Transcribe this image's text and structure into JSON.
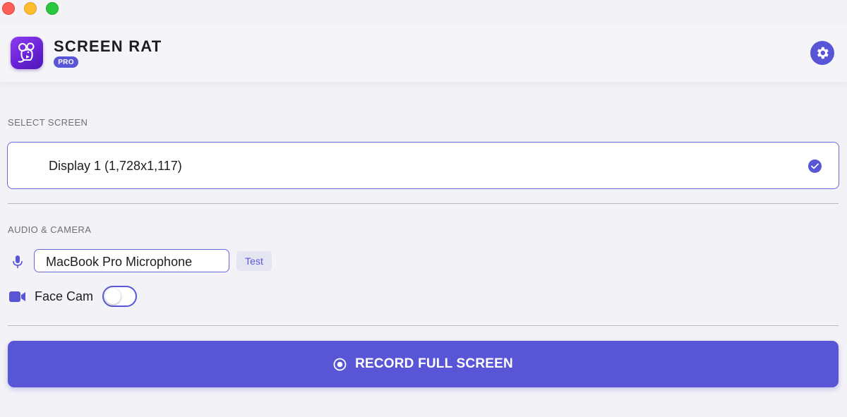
{
  "window": {
    "traffic_lights": [
      "close",
      "minimize",
      "maximize"
    ]
  },
  "header": {
    "app_name": "SCREEN RAT",
    "badge": "PRO",
    "app_icon": "rat-icon",
    "settings_icon": "gear-icon"
  },
  "select_screen": {
    "label": "SELECT SCREEN",
    "options": [
      {
        "label": "Display 1 (1,728x1,117)",
        "selected": true
      }
    ]
  },
  "audio_camera": {
    "label": "AUDIO & CAMERA",
    "microphone": {
      "icon": "microphone-icon",
      "value": "MacBook Pro Microphone",
      "test_label": "Test"
    },
    "face_cam": {
      "icon": "video-camera-icon",
      "label": "Face Cam",
      "enabled": false
    }
  },
  "record": {
    "icon": "record-icon",
    "label": "RECORD FULL SCREEN"
  },
  "colors": {
    "accent": "#5856d6",
    "background": "#f3f3f7",
    "close": "#fe5f57",
    "minimize": "#febc2e",
    "maximize": "#28c840"
  }
}
